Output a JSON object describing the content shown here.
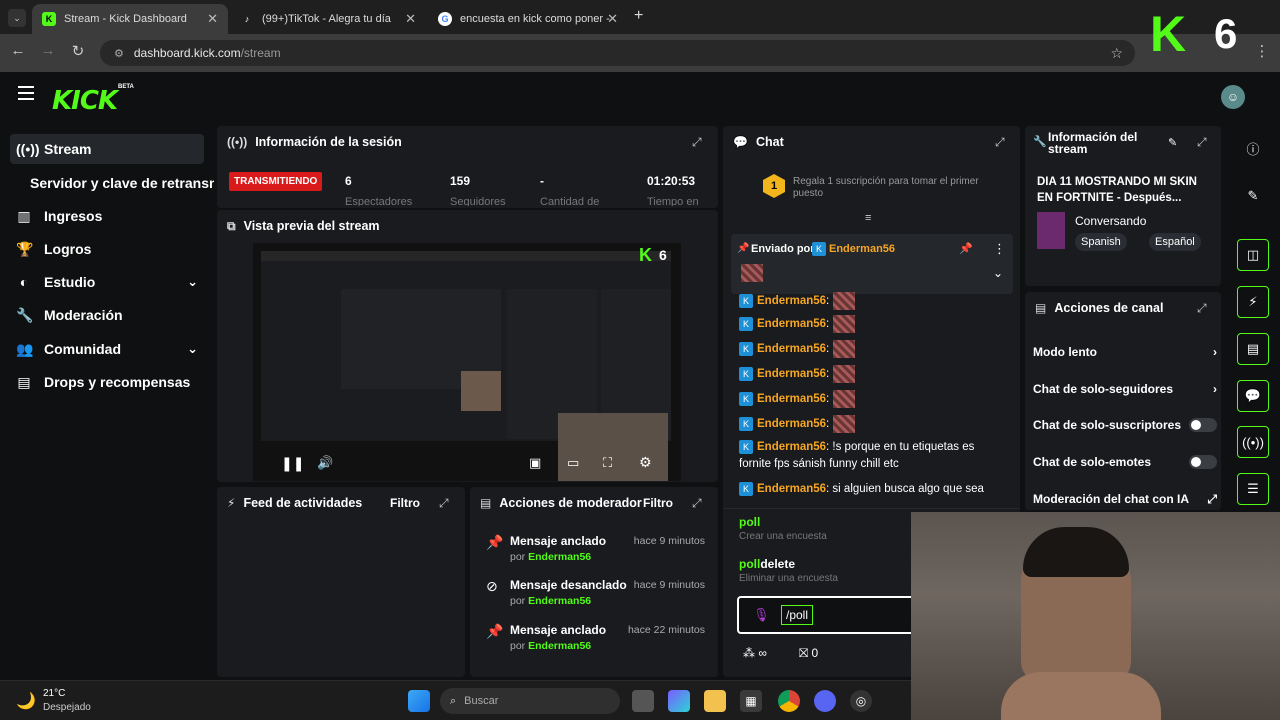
{
  "browser": {
    "tabs": [
      {
        "title": "Stream - Kick Dashboard",
        "fav": "K"
      },
      {
        "title": "(99+)TikTok - Alegra tu día",
        "fav": "♪"
      },
      {
        "title": "encuesta en kick como poner -",
        "fav": "G"
      }
    ],
    "url_host": "dashboard.kick.com",
    "url_path": "/stream"
  },
  "header": {
    "logo": "KICK",
    "beta": "BETA"
  },
  "sidebar": {
    "items": [
      {
        "label": "Stream",
        "icon": "broadcast-icon"
      },
      {
        "label": "Servidor y clave de retransm"
      },
      {
        "label": "Ingresos",
        "icon": "chart-icon"
      },
      {
        "label": "Logros",
        "icon": "trophy-icon"
      },
      {
        "label": "Estudio",
        "icon": "palette-icon"
      },
      {
        "label": "Moderación",
        "icon": "wrench-icon"
      },
      {
        "label": "Comunidad",
        "icon": "people-icon"
      },
      {
        "label": "Drops y recompensas",
        "icon": "gift-icon"
      }
    ]
  },
  "session": {
    "title": "Información de la sesión",
    "live": "TRANSMITIENDO",
    "stats": [
      {
        "value": "6",
        "label": "Espectadores"
      },
      {
        "value": "159",
        "label": "Seguidores"
      },
      {
        "value": "-",
        "label": "Cantidad de"
      },
      {
        "value": "01:20:53",
        "label": "Tiempo en"
      }
    ]
  },
  "preview": {
    "title": "Vista previa del stream",
    "overlay_logo": "K",
    "overlay_num": "6"
  },
  "feed": {
    "title": "Feed de actividades",
    "filter": "Filtro"
  },
  "modactions": {
    "title": "Acciones de moderador",
    "filter": "Filtro",
    "items": [
      {
        "title": "Mensaje anclado",
        "by": "por",
        "user": "Enderman56",
        "time": "hace 9 minutos"
      },
      {
        "title": "Mensaje desanclado",
        "by": "por",
        "user": "Enderman56",
        "time": "hace 9 minutos"
      },
      {
        "title": "Mensaje anclado",
        "by": "por",
        "user": "Enderman56",
        "time": "hace 22 minutos"
      }
    ]
  },
  "chat": {
    "title": "Chat",
    "sub_rank": "1",
    "sub_msg": "Regala 1 suscripción para tomar el primer puesto",
    "pinned_label": "Enviado por",
    "pinned_user": "Enderman56",
    "messages": [
      {
        "user": "Enderman56",
        "text": ":"
      },
      {
        "user": "Enderman56",
        "text": ":"
      },
      {
        "user": "Enderman56",
        "text": ":"
      },
      {
        "user": "Enderman56",
        "text": ":"
      },
      {
        "user": "Enderman56",
        "text": ":"
      },
      {
        "user": "Enderman56",
        "text": ":"
      },
      {
        "user": "Enderman56",
        "text": ": !s porque en tu etiquetas es",
        "cont": "fornite fps sánish funny chill etc"
      },
      {
        "user": "Enderman56",
        "text": ": si alguien busca algo que sea"
      }
    ],
    "commands": [
      {
        "cmd": "poll",
        "desc": "Crear una encuesta"
      },
      {
        "cmd_green": "poll",
        "cmd_rest": "delete",
        "desc": "Eliminar una encuesta"
      }
    ],
    "input_value": "/poll",
    "footer_points": "∞",
    "footer_count": "0"
  },
  "streaminfo": {
    "title": "Información del stream",
    "stream_title": "DIA 11 MOSTRANDO MI SKIN EN FORTNITE - Después...",
    "category": "Conversando",
    "tags": [
      "Spanish",
      "Español"
    ]
  },
  "channel": {
    "title": "Acciones de canal",
    "items": [
      {
        "label": "Modo lento",
        "type": "arrow"
      },
      {
        "label": "Chat de solo-seguidores",
        "type": "arrow"
      },
      {
        "label": "Chat de solo-suscriptores",
        "type": "toggle"
      },
      {
        "label": "Chat de solo-emotes",
        "type": "toggle"
      },
      {
        "label": "Moderación del chat con IA",
        "type": "link"
      }
    ]
  },
  "taskbar": {
    "temp": "21°C",
    "weather": "Despejado",
    "search": "Buscar"
  },
  "overlay": {
    "logo": "K",
    "num": "6"
  }
}
